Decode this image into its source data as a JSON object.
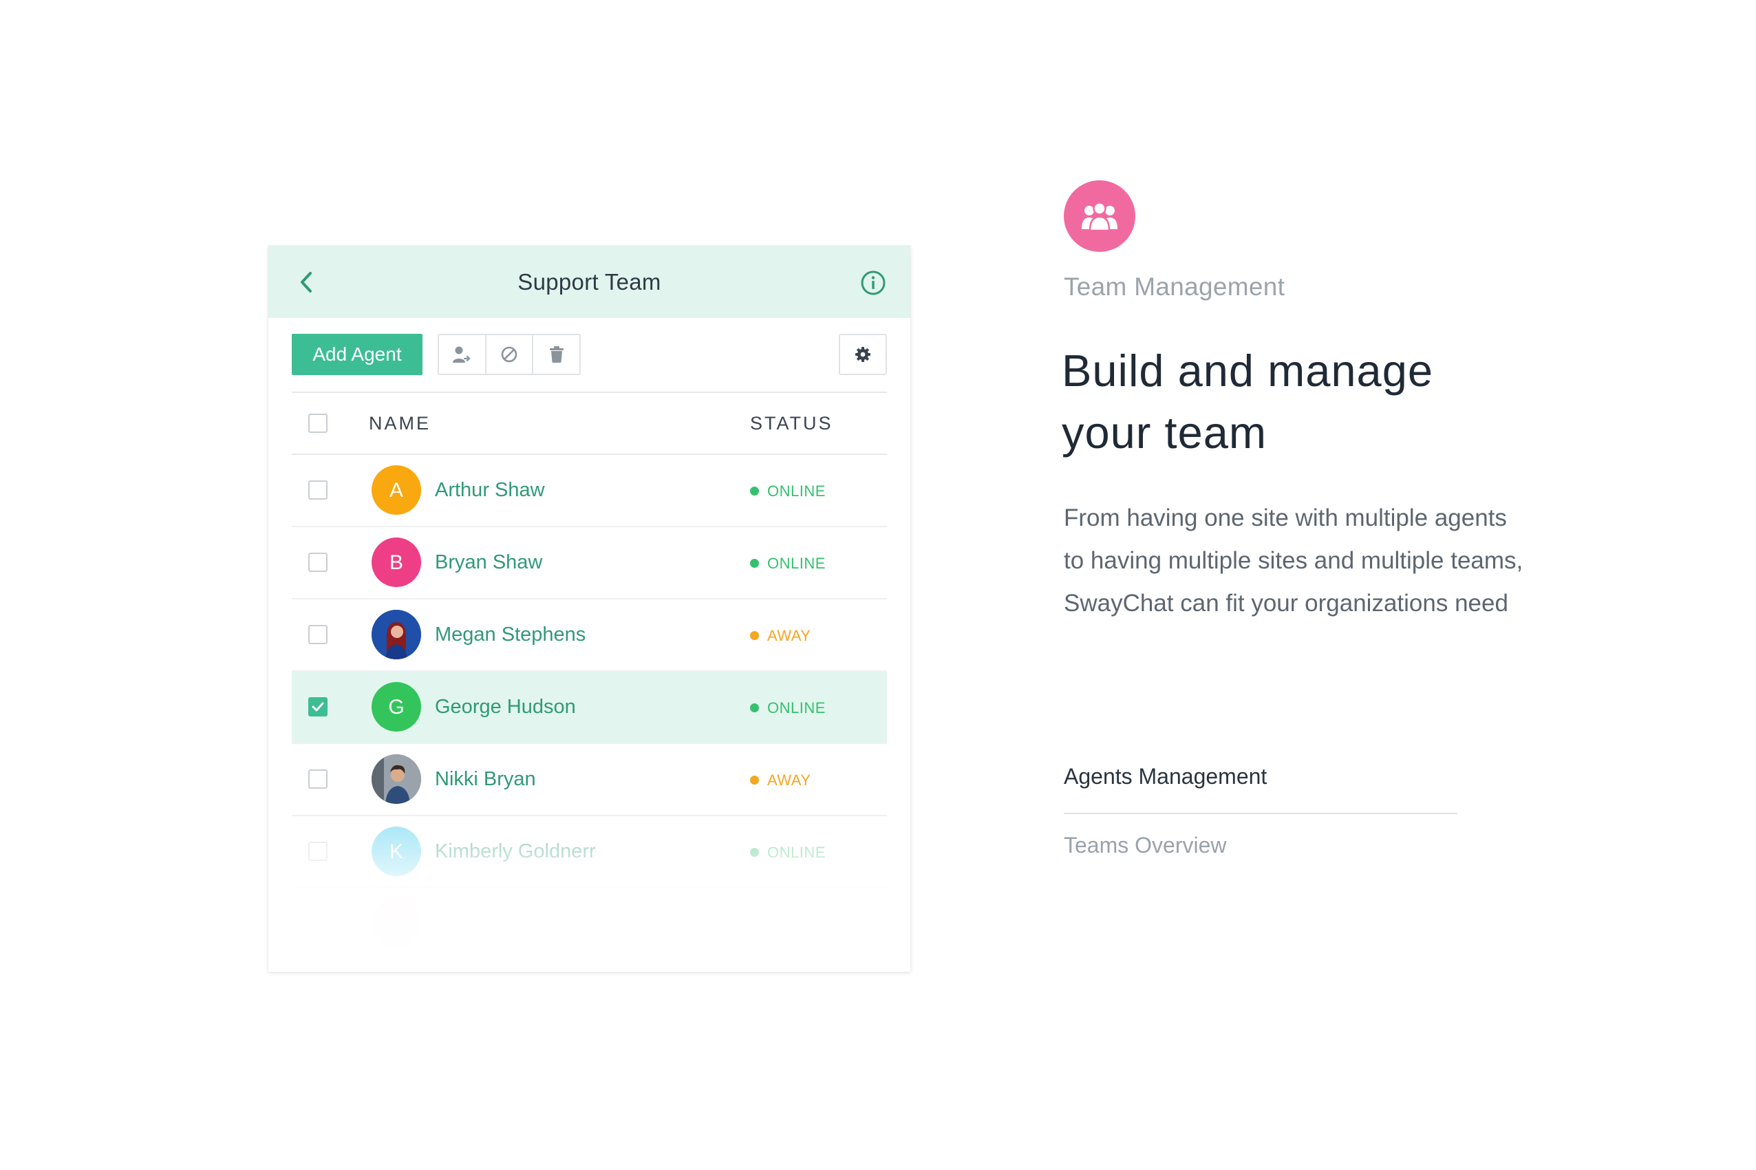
{
  "card": {
    "title": "Support Team",
    "add_agent_label": "Add Agent",
    "columns": {
      "name": "NAME",
      "status": "STATUS"
    }
  },
  "agents": [
    {
      "name": "Arthur Shaw",
      "initial": "A",
      "avatar_color": "#f9a80f",
      "status": "ONLINE",
      "status_color": "#35c06f",
      "selected": false
    },
    {
      "name": "Bryan Shaw",
      "initial": "B",
      "avatar_color": "#ee3f86",
      "status": "ONLINE",
      "status_color": "#35c06f",
      "selected": false
    },
    {
      "name": "Megan Stephens",
      "initial": "",
      "avatar_color": "#1f4fa8",
      "status": "AWAY",
      "status_color": "#f5a623",
      "selected": false
    },
    {
      "name": "George Hudson",
      "initial": "G",
      "avatar_color": "#33c45c",
      "status": "ONLINE",
      "status_color": "#35c06f",
      "selected": true
    },
    {
      "name": "Nikki Bryan",
      "initial": "",
      "avatar_color": "#6b7580",
      "status": "AWAY",
      "status_color": "#f5a623",
      "selected": false
    },
    {
      "name": "Kimberly Goldnerr",
      "initial": "K",
      "avatar_color": "#4fcff0",
      "status": "ONLINE",
      "status_color": "#35c06f",
      "selected": false
    }
  ],
  "feature": {
    "eyebrow": "Team Management",
    "headline_line1": "Build and manage",
    "headline_line2": "your team",
    "body": "From having one site with multiple agents to having multiple sites and multiple teams, SwayChat can fit your organizations need",
    "nav_active": "Agents Management",
    "nav_inactive": "Teams Overview"
  },
  "colors": {
    "accent": "#3dbd93",
    "header_bg": "#e1f4ee",
    "feature_icon": "#f06aa0"
  },
  "icons": {
    "back": "chevron-left-icon",
    "info": "info-circle-icon",
    "assign": "user-transfer-icon",
    "disable": "block-icon",
    "delete": "trash-icon",
    "settings": "gear-icon",
    "feature": "team-users-icon"
  }
}
